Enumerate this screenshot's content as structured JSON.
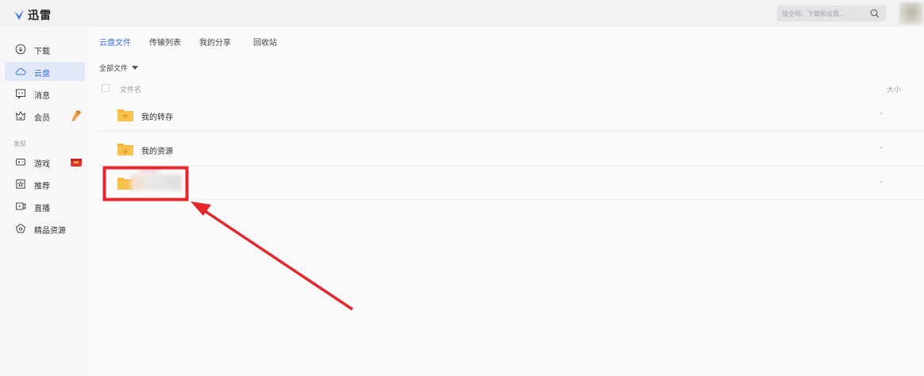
{
  "app": {
    "title": "迅雷",
    "brand_color": "#3a70e6"
  },
  "search": {
    "placeholder": "搜全网、下载和云盘…",
    "icon": "search-icon"
  },
  "sidebar": {
    "items": [
      {
        "label": "下载",
        "icon": "download-icon",
        "active": false
      },
      {
        "label": "云盘",
        "icon": "cloud-icon",
        "active": true
      },
      {
        "label": "消息",
        "icon": "message-icon",
        "active": false
      },
      {
        "label": "会员",
        "icon": "member-icon",
        "active": false,
        "badge": "vip-badge-icon"
      }
    ],
    "section_label": "发现",
    "discover_items": [
      {
        "label": "游戏",
        "icon": "game-icon",
        "badge": "gift-badge-icon"
      },
      {
        "label": "推荐",
        "icon": "star-icon"
      },
      {
        "label": "直播",
        "icon": "live-icon"
      },
      {
        "label": "精品资源",
        "icon": "gem-icon"
      }
    ]
  },
  "tabs": [
    {
      "label": "云盘文件",
      "active": true
    },
    {
      "label": "传输列表",
      "active": false
    },
    {
      "label": "我的分享",
      "active": false
    },
    {
      "label": "回收站",
      "active": false
    }
  ],
  "filter": {
    "label": "全部文件"
  },
  "table": {
    "col_name": "文件名",
    "col_size": "大小",
    "rows": [
      {
        "name": "我的转存",
        "size": "-",
        "icon": "folder-transfer-icon"
      },
      {
        "name": "我的资源",
        "size": "-",
        "icon": "folder-download-icon"
      },
      {
        "name": "",
        "size": "-",
        "icon": "folder-icon",
        "obscured": true
      }
    ]
  },
  "annotation": {
    "color": "#e5262c"
  }
}
